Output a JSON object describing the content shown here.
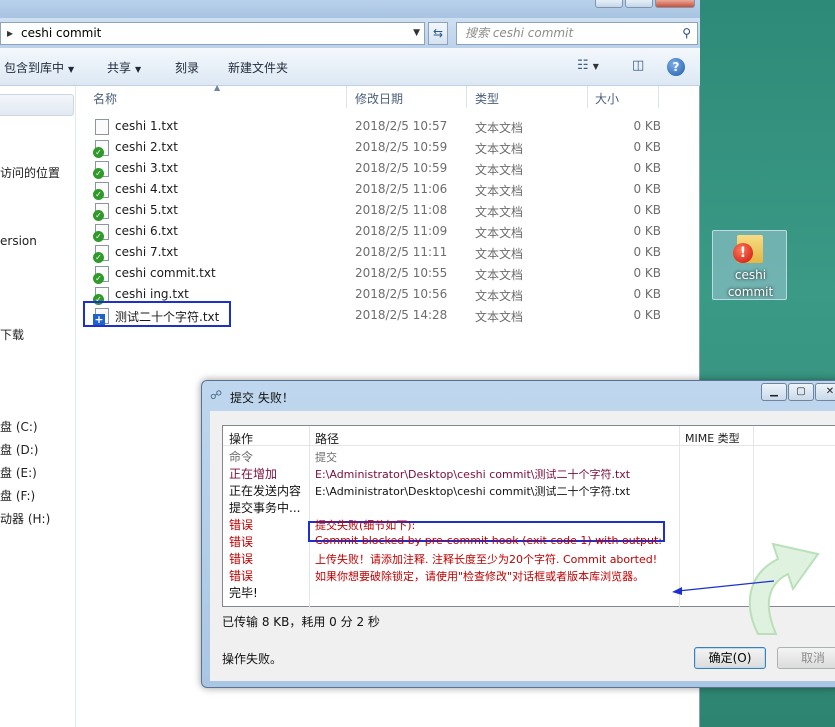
{
  "explorer": {
    "address": "ceshi commit",
    "search_placeholder": "搜索 ceshi commit",
    "toolbar": {
      "include_library": "包含到库中",
      "share": "共享",
      "burn": "刻录",
      "new_folder": "新建文件夹"
    },
    "nav": [
      "访问的位置",
      "ersion",
      "下载",
      "盘 (C:)",
      "盘 (D:)",
      "盘 (E:)",
      "盘 (F:)",
      "动器 (H:)"
    ],
    "columns": {
      "name": "名称",
      "date": "修改日期",
      "type": "类型",
      "size": "大小"
    },
    "files": [
      {
        "name": "ceshi 1.txt",
        "date": "2018/2/5 10:57",
        "type": "文本文档",
        "size": "0 KB",
        "status": "normal"
      },
      {
        "name": "ceshi 2.txt",
        "date": "2018/2/5 10:59",
        "type": "文本文档",
        "size": "0 KB",
        "status": "ok"
      },
      {
        "name": "ceshi 3.txt",
        "date": "2018/2/5 10:59",
        "type": "文本文档",
        "size": "0 KB",
        "status": "ok"
      },
      {
        "name": "ceshi 4.txt",
        "date": "2018/2/5 11:06",
        "type": "文本文档",
        "size": "0 KB",
        "status": "ok"
      },
      {
        "name": "ceshi 5.txt",
        "date": "2018/2/5 11:08",
        "type": "文本文档",
        "size": "0 KB",
        "status": "ok"
      },
      {
        "name": "ceshi 6.txt",
        "date": "2018/2/5 11:09",
        "type": "文本文档",
        "size": "0 KB",
        "status": "ok"
      },
      {
        "name": "ceshi 7.txt",
        "date": "2018/2/5 11:11",
        "type": "文本文档",
        "size": "0 KB",
        "status": "ok"
      },
      {
        "name": "ceshi commit.txt",
        "date": "2018/2/5 10:55",
        "type": "文本文档",
        "size": "0 KB",
        "status": "ok"
      },
      {
        "name": "ceshi ing.txt",
        "date": "2018/2/5 10:56",
        "type": "文本文档",
        "size": "0 KB",
        "status": "ok"
      },
      {
        "name": "测试二十个字符.txt",
        "date": "2018/2/5 14:28",
        "type": "文本文档",
        "size": "0 KB",
        "status": "added"
      }
    ]
  },
  "desktop_icon": {
    "line1": "ceshi",
    "line2": "commit"
  },
  "dialog": {
    "title": "提交 失败！",
    "columns": {
      "action": "操作",
      "path": "路径",
      "mime": "MIME 类型"
    },
    "rows": [
      {
        "action": "命令",
        "path": "提交",
        "action_color": "#6d6d6d",
        "path_color": "#6d6d6d"
      },
      {
        "action": "正在增加",
        "path": "E:\\Administrator\\Desktop\\ceshi commit\\测试二十个字符.txt",
        "action_color": "#7a0d3a",
        "path_color": "#7a0d3a"
      },
      {
        "action": "正在发送内容",
        "path": "E:\\Administrator\\Desktop\\ceshi commit\\测试二十个字符.txt",
        "action_color": "#111111",
        "path_color": "#111111"
      },
      {
        "action": "提交事务中...",
        "path": "",
        "action_color": "#111111",
        "path_color": "#111111"
      },
      {
        "action": "错误",
        "path": "提交失败(细节如下):",
        "action_color": "#c00000",
        "path_color": "#c00000"
      },
      {
        "action": "错误",
        "path": "Commit blocked by pre-commit hook (exit code 1) with output:",
        "action_color": "#c00000",
        "path_color": "#c00000"
      },
      {
        "action": "错误",
        "path": "上传失败！请添加注释. 注释长度至少为20个字符. Commit aborted!",
        "action_color": "#c00000",
        "path_color": "#c00000"
      },
      {
        "action": "错误",
        "path": "如果你想要破除锁定，请使用\"检查修改\"对话框或者版本库浏览器。",
        "action_color": "#c00000",
        "path_color": "#c00000"
      },
      {
        "action": "完毕!",
        "path": "",
        "action_color": "#111111",
        "path_color": "#111111"
      }
    ],
    "transferred": "已传输 8 KB，耗用 0 分 2 秒",
    "status": "操作失败。",
    "ok_label": "确定(O)",
    "cancel_label": "取消"
  }
}
